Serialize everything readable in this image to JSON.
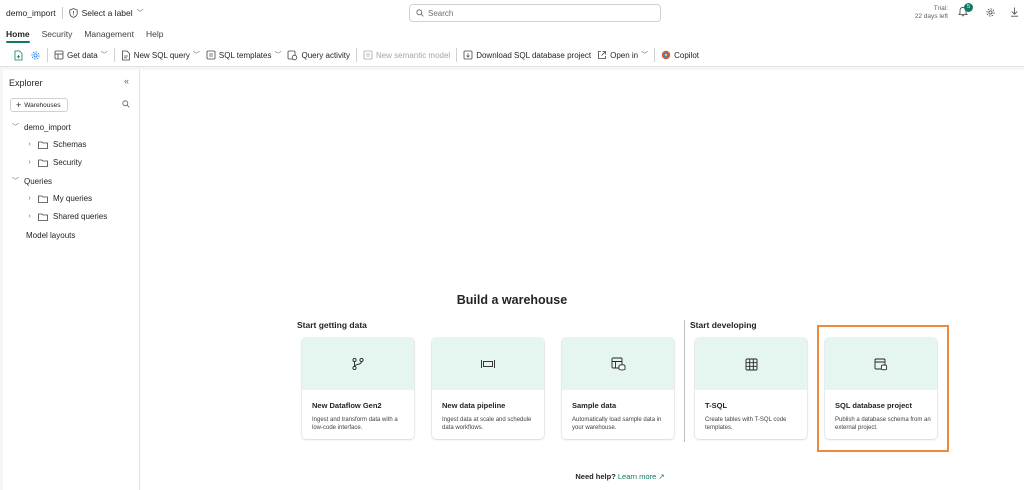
{
  "topbar": {
    "workspace": "demo_import",
    "label_selector": "Select a label",
    "search_placeholder": "Search",
    "trial_line1": "Trial:",
    "trial_line2": "22 days left",
    "notification_count": "5"
  },
  "tabs": [
    {
      "label": "Home",
      "active": true
    },
    {
      "label": "Security"
    },
    {
      "label": "Management"
    },
    {
      "label": "Help"
    }
  ],
  "toolbar": {
    "get_data": "Get data",
    "new_sql_query": "New SQL query",
    "sql_templates": "SQL templates",
    "query_activity": "Query activity",
    "new_semantic_model": "New semantic model",
    "download_project": "Download SQL database project",
    "open_in": "Open in",
    "copilot": "Copilot"
  },
  "explorer": {
    "title": "Explorer",
    "warehouses_button": "Warehouses",
    "tree": {
      "root": "demo_import",
      "schemas": "Schemas",
      "security": "Security",
      "queries": "Queries",
      "my_queries": "My queries",
      "shared_queries": "Shared queries",
      "model_layouts": "Model layouts"
    }
  },
  "main": {
    "title": "Build a warehouse",
    "section_getting_data": "Start getting data",
    "section_developing": "Start developing",
    "cards": [
      {
        "title": "New Dataflow Gen2",
        "desc": "Ingest and transform data with a low-code interface."
      },
      {
        "title": "New data pipeline",
        "desc": "Ingest data at scale and schedule data workflows."
      },
      {
        "title": "Sample data",
        "desc": "Automatically load sample data in your warehouse."
      },
      {
        "title": "T-SQL",
        "desc": "Create tables with T-SQL code templates."
      },
      {
        "title": "SQL database project",
        "desc": "Publish a database schema from an external project."
      }
    ],
    "help_question": "Need help?",
    "help_link": "Learn more"
  },
  "colors": {
    "accent": "#117865",
    "card_header": "#e5f5ef",
    "highlight": "#ef8a3d"
  }
}
